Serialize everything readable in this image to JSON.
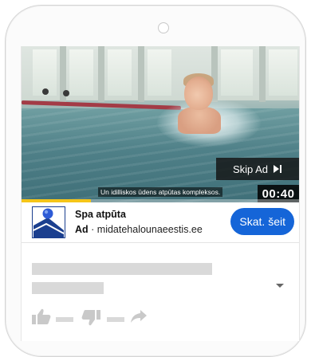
{
  "player": {
    "skip_label": "Skip Ad",
    "caption": "Un idilliskos ūdens atpūtas kompleksos.",
    "time_remaining": "00:40",
    "progress_percent": 25,
    "accent_color": "#f5c518"
  },
  "ad": {
    "title": "Spa atpūta",
    "badge": "Ad",
    "separator": " · ",
    "domain": "midatehalounaeestis.ee",
    "cta_label": "Skat. šeit",
    "cta_color": "#1565d8"
  },
  "icons": {
    "skip": "skip-next-icon",
    "logo": "spa-logo",
    "expand": "chevron-down-icon",
    "like": "thumbs-up-icon",
    "dislike": "thumbs-down-icon",
    "share": "share-arrow-icon"
  }
}
